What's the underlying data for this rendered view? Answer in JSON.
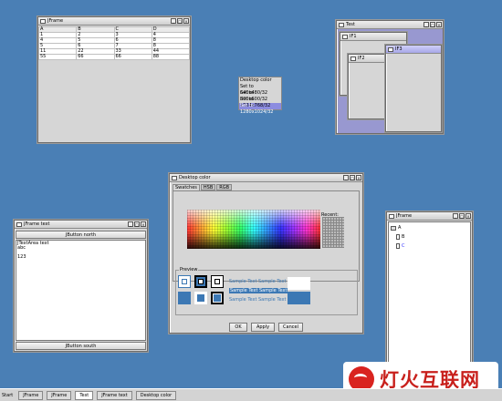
{
  "desktop": {
    "background": "#4a7fb5"
  },
  "jframe_table": {
    "title": "JFrame",
    "columns": [
      "A",
      "B",
      "C",
      "D"
    ],
    "rows": [
      [
        "1",
        "2",
        "3",
        "4"
      ],
      [
        "4",
        "5",
        "6",
        "8"
      ],
      [
        "5",
        "6",
        "7",
        "8"
      ],
      [
        "11",
        "22",
        "33",
        "44"
      ],
      [
        "55",
        "66",
        "66",
        "88"
      ]
    ]
  },
  "test_window": {
    "title": "Test",
    "if1": "IF1",
    "if2": "IF2",
    "if3": "IF3"
  },
  "popup_menu": {
    "header": "Desktop color",
    "items": [
      "Set to 640x480/32",
      "Set to 800x600/32",
      "Set to 1024x768/32",
      "Set to 1280x1024/32"
    ]
  },
  "color_dialog": {
    "title": "Desktop color",
    "tabs": [
      "Swatches",
      "HSB",
      "RGB"
    ],
    "recent_label": "Recent:",
    "preview_label": "Preview",
    "sample_text": "Sample Text",
    "ok": "OK",
    "apply": "Apply",
    "cancel": "Cancel",
    "accent": "#3c78b4"
  },
  "jframe_text": {
    "title": "JFrame text",
    "north": "JButton north",
    "text": "JTextArea text\nabc\n\n123",
    "south": "JButton south"
  },
  "jframe_tree": {
    "title": "JFrame",
    "nodes": [
      "A",
      "B",
      "C"
    ]
  },
  "taskbar": {
    "start": "Start",
    "tasks": [
      "JFrame",
      "JFrame",
      "Test",
      "JFrame text",
      "Desktop color"
    ],
    "active": 2
  },
  "watermark": {
    "text": "灯火互联网"
  }
}
